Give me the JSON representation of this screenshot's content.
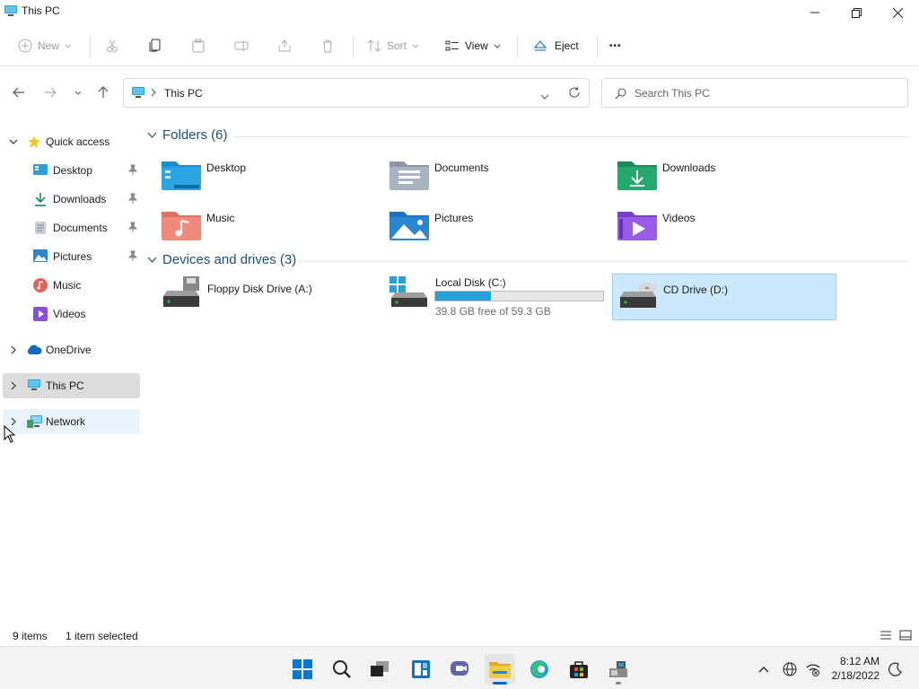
{
  "window": {
    "title": "This PC"
  },
  "toolbar": {
    "new_label": "New",
    "sort_label": "Sort",
    "view_label": "View",
    "eject_label": "Eject",
    "more_label": "•••"
  },
  "address": {
    "location": "This PC"
  },
  "search": {
    "placeholder": "Search This PC"
  },
  "sidebar": {
    "quick_access": "Quick access",
    "items": [
      {
        "label": "Desktop",
        "pinned": true
      },
      {
        "label": "Downloads",
        "pinned": true
      },
      {
        "label": "Documents",
        "pinned": true
      },
      {
        "label": "Pictures",
        "pinned": true
      },
      {
        "label": "Music",
        "pinned": false
      },
      {
        "label": "Videos",
        "pinned": false
      }
    ],
    "onedrive": "OneDrive",
    "thispc": "This PC",
    "network": "Network"
  },
  "folders": {
    "header": "Folders (6)",
    "items": [
      {
        "label": "Desktop",
        "icon": "desktop-folder-icon"
      },
      {
        "label": "Documents",
        "icon": "documents-folder-icon"
      },
      {
        "label": "Downloads",
        "icon": "downloads-folder-icon"
      },
      {
        "label": "Music",
        "icon": "music-folder-icon"
      },
      {
        "label": "Pictures",
        "icon": "pictures-folder-icon"
      },
      {
        "label": "Videos",
        "icon": "videos-folder-icon"
      }
    ]
  },
  "drives": {
    "header": "Devices and drives (3)",
    "items": [
      {
        "label": "Floppy Disk Drive (A:)"
      },
      {
        "label": "Local Disk (C:)",
        "free_text": "39.8 GB free of 59.3 GB",
        "used_fraction": 0.33
      },
      {
        "label": "CD Drive (D:)",
        "selected": true
      }
    ]
  },
  "status": {
    "count": "9 items",
    "selection": "1 item selected"
  },
  "taskbar": {
    "time": "8:12 AM",
    "date": "2/18/2022"
  },
  "colors": {
    "accent": "#0078d4",
    "selection": "#cce8ff",
    "sidebar_selected": "#dcdcdc",
    "header_text": "#1f4e79"
  }
}
